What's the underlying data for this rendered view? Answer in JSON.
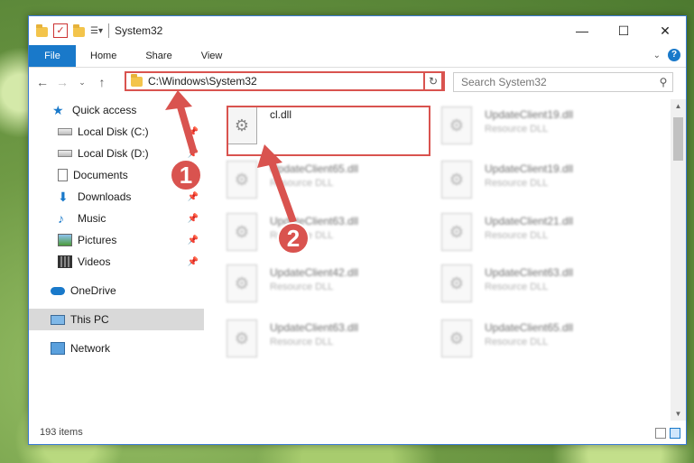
{
  "window": {
    "title": "System32",
    "controls": {
      "minimize": "—",
      "maximize": "☐",
      "close": "✕"
    }
  },
  "ribbon": {
    "file_tab": "File",
    "tabs": [
      "Home",
      "Share",
      "View"
    ],
    "help": "?"
  },
  "address_bar": {
    "path": "C:\\Windows\\System32",
    "search_placeholder": "Search System32"
  },
  "sidebar": {
    "items": [
      {
        "label": "Quick access",
        "icon": "star-icon",
        "pinned": false
      },
      {
        "label": "Local Disk (C:)",
        "icon": "disk-icon",
        "pinned": true
      },
      {
        "label": "Local Disk (D:)",
        "icon": "disk-icon",
        "pinned": true
      },
      {
        "label": "Documents",
        "icon": "document-icon",
        "pinned": true
      },
      {
        "label": "Downloads",
        "icon": "download-icon",
        "pinned": true
      },
      {
        "label": "Music",
        "icon": "music-icon",
        "pinned": true
      },
      {
        "label": "Pictures",
        "icon": "pictures-icon",
        "pinned": true
      },
      {
        "label": "Videos",
        "icon": "videos-icon",
        "pinned": true
      },
      {
        "label": "OneDrive",
        "icon": "cloud-icon",
        "pinned": false
      },
      {
        "label": "This PC",
        "icon": "pc-icon",
        "pinned": false,
        "selected": true
      },
      {
        "label": "Network",
        "icon": "network-icon",
        "pinned": false
      }
    ]
  },
  "files": [
    {
      "name": "cl.dll",
      "type": "",
      "selected": true
    },
    {
      "name": "UpdateClient19.dll",
      "type": "Resource DLL"
    },
    {
      "name": "UpdateClient65.dll",
      "type": "Resource DLL"
    },
    {
      "name": "UpdateClient19.dll",
      "type": "Resource DLL"
    },
    {
      "name": "UpdateClient63.dll",
      "type": "Resource DLL"
    },
    {
      "name": "UpdateClient21.dll",
      "type": "Resource DLL"
    },
    {
      "name": "UpdateClient42.dll",
      "type": "Resource DLL"
    },
    {
      "name": "UpdateClient63.dll",
      "type": "Resource DLL"
    },
    {
      "name": "UpdateClient63.dll",
      "type": "Resource DLL"
    },
    {
      "name": "UpdateClient65.dll",
      "type": "Resource DLL"
    }
  ],
  "status": {
    "item_count": "193 items"
  },
  "annotations": {
    "step1": "1",
    "step2": "2"
  },
  "colors": {
    "accent": "#1979ca",
    "highlight": "#d9534f"
  }
}
